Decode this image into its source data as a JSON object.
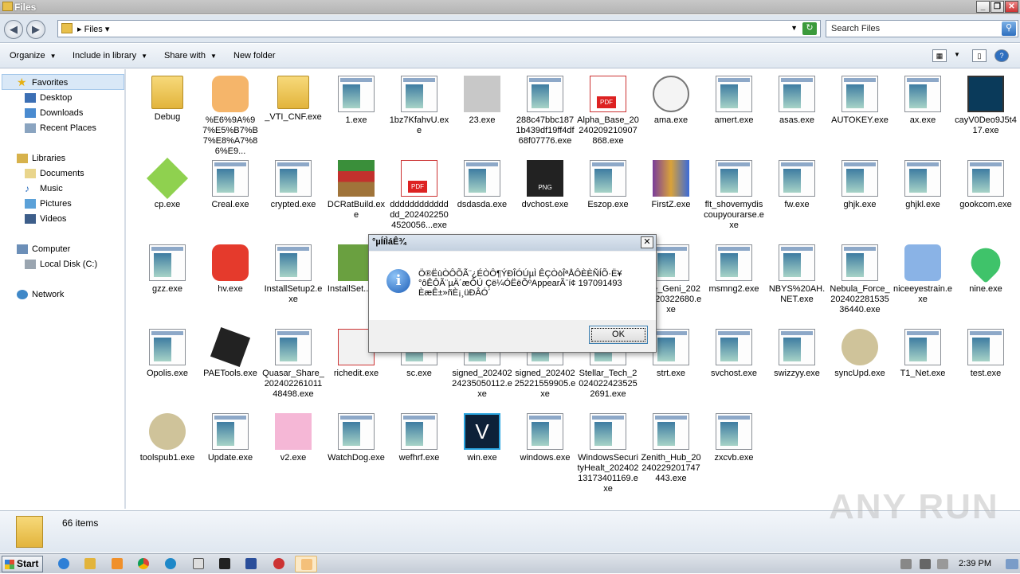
{
  "window": {
    "title": "Files"
  },
  "address": {
    "path": "Files",
    "search_placeholder": "Search Files"
  },
  "toolbar": {
    "organize": "Organize",
    "include": "Include in library",
    "share": "Share with",
    "new_folder": "New folder"
  },
  "nav": {
    "favorites": "Favorites",
    "desktop": "Desktop",
    "downloads": "Downloads",
    "recent": "Recent Places",
    "libraries": "Libraries",
    "documents": "Documents",
    "music": "Music",
    "pictures": "Pictures",
    "videos": "Videos",
    "computer": "Computer",
    "local_disk": "Local Disk (C:)",
    "network": "Network"
  },
  "files": [
    {
      "name": "Debug",
      "icon": "folder"
    },
    {
      "name": "%E6%9A%97%E5%B7%B7%E8%A7%86%E9...",
      "icon": "cat-app"
    },
    {
      "name": "_VTI_CNF.exe",
      "icon": "folder"
    },
    {
      "name": "1.exe",
      "icon": "exe"
    },
    {
      "name": "1bz7KfahvU.exe",
      "icon": "exe"
    },
    {
      "name": "23.exe",
      "icon": "blurred"
    },
    {
      "name": "288c47bbc1871b439df19ff4df68f07776.exe",
      "icon": "exe"
    },
    {
      "name": "Alpha_Base_20240209210907868.exe",
      "icon": "pdf"
    },
    {
      "name": "ama.exe",
      "icon": "gauge"
    },
    {
      "name": "amert.exe",
      "icon": "exe"
    },
    {
      "name": "asas.exe",
      "icon": "exe"
    },
    {
      "name": "AUTOKEY.exe",
      "icon": "exe"
    },
    {
      "name": "ax.exe",
      "icon": "exe"
    },
    {
      "name": "cayV0Deo9J5t417.exe",
      "icon": "monitor"
    },
    {
      "name": "cp.exe",
      "icon": "cube"
    },
    {
      "name": "Creal.exe",
      "icon": "exe"
    },
    {
      "name": "crypted.exe",
      "icon": "exe"
    },
    {
      "name": "DCRatBuild.exe",
      "icon": "archive"
    },
    {
      "name": "dddddddddddddd_2024022504520056...exe",
      "icon": "pdf"
    },
    {
      "name": "dsdasda.exe",
      "icon": "exe"
    },
    {
      "name": "dvchost.exe",
      "icon": "png"
    },
    {
      "name": "Eszop.exe",
      "icon": "exe"
    },
    {
      "name": "FirstZ.exe",
      "icon": "rar"
    },
    {
      "name": "flt_shovemydiscoupyourarse.exe",
      "icon": "exe"
    },
    {
      "name": "fw.exe",
      "icon": "exe"
    },
    {
      "name": "ghjk.exe",
      "icon": "exe"
    },
    {
      "name": "ghjkl.exe",
      "icon": "exe"
    },
    {
      "name": "gookcom.exe",
      "icon": "exe"
    },
    {
      "name": "gzz.exe",
      "icon": "exe"
    },
    {
      "name": "hv.exe",
      "icon": "player"
    },
    {
      "name": "InstallSetup2.exe",
      "icon": "exe"
    },
    {
      "name": "InstallSet...exe",
      "icon": "amazon"
    },
    {
      "name": "",
      "icon": "hidden"
    },
    {
      "name": "",
      "icon": "hidden"
    },
    {
      "name": "",
      "icon": "hidden"
    },
    {
      "name": "",
      "icon": "hidden"
    },
    {
      "name": "acle_Geni_20240220322680.exe",
      "icon": "exe"
    },
    {
      "name": "msmng2.exe",
      "icon": "exe"
    },
    {
      "name": "NBYS%20AH.NET.exe",
      "icon": "exe"
    },
    {
      "name": "Nebula_Force_20240228153536440.exe",
      "icon": "exe"
    },
    {
      "name": "niceeyestrain.exe",
      "icon": "network"
    },
    {
      "name": "nine.exe",
      "icon": "heart"
    },
    {
      "name": "Opolis.exe",
      "icon": "exe"
    },
    {
      "name": "PAETools.exe",
      "icon": "chip"
    },
    {
      "name": "Quasar_Share_20240226101148498.exe",
      "icon": "exe"
    },
    {
      "name": "richedit.exe",
      "icon": "dice"
    },
    {
      "name": "sc.exe",
      "icon": "exe"
    },
    {
      "name": "signed_20240224235050112.exe",
      "icon": "exe"
    },
    {
      "name": "signed_20240225221559905.exe",
      "icon": "exe"
    },
    {
      "name": "Stellar_Tech_20240224235252691.exe",
      "icon": "exe"
    },
    {
      "name": "strt.exe",
      "icon": "exe"
    },
    {
      "name": "svchost.exe",
      "icon": "exe"
    },
    {
      "name": "swizzyy.exe",
      "icon": "exe"
    },
    {
      "name": "syncUpd.exe",
      "icon": "bubble"
    },
    {
      "name": "T1_Net.exe",
      "icon": "exe"
    },
    {
      "name": "test.exe",
      "icon": "exe"
    },
    {
      "name": "toolspub1.exe",
      "icon": "bubble"
    },
    {
      "name": "Update.exe",
      "icon": "exe"
    },
    {
      "name": "v2.exe",
      "icon": "pink-doc"
    },
    {
      "name": "WatchDog.exe",
      "icon": "exe"
    },
    {
      "name": "wefhrf.exe",
      "icon": "exe"
    },
    {
      "name": "win.exe",
      "icon": "v-logo"
    },
    {
      "name": "windows.exe",
      "icon": "exe"
    },
    {
      "name": "WindowsSecurityHealt_20240213173401169.exe",
      "icon": "exe"
    },
    {
      "name": "Zenith_Hub_20240229201747443.exe",
      "icon": "exe"
    },
    {
      "name": "zxcvb.exe",
      "icon": "exe"
    }
  ],
  "status": {
    "count": "66 items"
  },
  "watermark": "ANY RUN",
  "dialog": {
    "title": "°µÍíÌáÊ¾",
    "message": "Ö®ËùÒÔÕÃ¨¿ÉÒÔ¶ÝÐÎÓÚµÌ ÊÇÒòÎªÅÔÈÈÑÍÕ·Ë¥°ôÊÔÃ¨µÄ´æÔÚ Çë¼ÓËëÕºAppearÃ¨í¢ 197091493 ÈæÊ±»ñÈ¡¸üÐÂÓ´",
    "ok": "OK"
  },
  "taskbar": {
    "start": "Start",
    "clock": "2:39 PM"
  }
}
